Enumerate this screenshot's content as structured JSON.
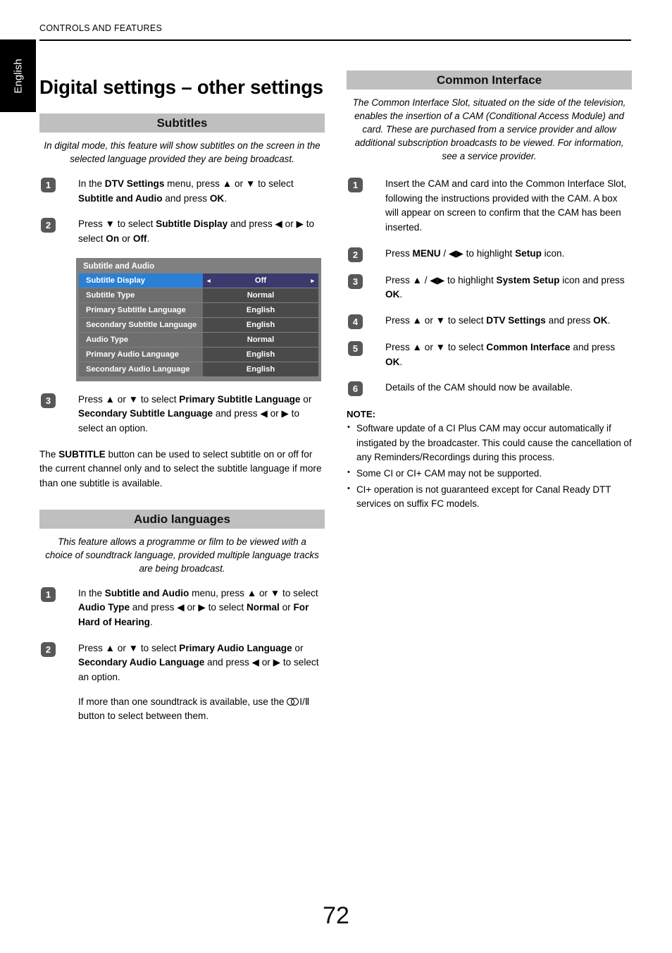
{
  "header": {
    "running_head": "CONTROLS AND FEATURES",
    "language_tab": "English",
    "page_title": "Digital settings – other settings"
  },
  "left_column": {
    "subtitles": {
      "heading": "Subtitles",
      "intro": "In digital mode, this feature will show subtitles on the screen in the selected language provided they are being broadcast.",
      "steps": [
        {
          "number": "1",
          "text_parts": [
            "In the ",
            "DTV Settings",
            " menu, press ▲ or ▼ to select ",
            "Subtitle and Audio",
            " and press ",
            "OK",
            "."
          ]
        },
        {
          "number": "2",
          "text_parts": [
            "Press ▼ to select ",
            "Subtitle Display",
            " and press ◀ or ▶ to select ",
            "On",
            " or ",
            "Off",
            "."
          ]
        },
        {
          "number": "3",
          "text_parts": [
            "Press ▲ or ▼ to select ",
            "Primary Subtitle Language",
            " or ",
            "Secondary Subtitle Language",
            " and press ◀ or ▶ to select an option."
          ]
        }
      ],
      "closing_paragraph": {
        "before": "The ",
        "bold": "SUBTITLE",
        "after": " button can be used to select subtitle on or off for the current channel only and to select the subtitle language if more than one subtitle is available."
      }
    },
    "tv_menu": {
      "title": "Subtitle and Audio",
      "rows": [
        {
          "label": "Subtitle Display",
          "value": "Off",
          "selected": true
        },
        {
          "label": "Subtitle Type",
          "value": "Normal",
          "selected": false
        },
        {
          "label": "Primary Subtitle Language",
          "value": "English",
          "selected": false
        },
        {
          "label": "Secondary Subtitle Language",
          "value": "English",
          "selected": false
        },
        {
          "label": "Audio Type",
          "value": "Normal",
          "selected": false
        },
        {
          "label": "Primary Audio Language",
          "value": "English",
          "selected": false
        },
        {
          "label": "Secondary Audio Language",
          "value": "English",
          "selected": false
        }
      ],
      "caret_left": "◂",
      "caret_right": "▸",
      "colors": {
        "frame": "#808080",
        "label_bg": "#6e6e6e",
        "value_bg": "#4a4a4a",
        "selected_label_bg": "#2b7fd4",
        "selected_value_bg": "#3a3a6e",
        "text": "#ffffff"
      }
    },
    "audio_languages": {
      "heading": "Audio languages",
      "intro": "This feature allows a programme or film to be viewed with a choice of soundtrack language, provided multiple language tracks are being broadcast.",
      "steps": [
        {
          "number": "1",
          "text_parts": [
            "In the ",
            "Subtitle and Audio",
            " menu, press ▲ or ▼ to select ",
            "Audio Type",
            " and press ◀ or ▶ to select ",
            "Normal",
            " or ",
            "For Hard of Hearing",
            "."
          ]
        },
        {
          "number": "2",
          "text_parts": [
            "Press ▲ or ▼ to select ",
            "Primary Audio Language",
            " or ",
            "Secondary Audio Language",
            " and press ◀ or ▶ to select an option."
          ]
        }
      ],
      "sub_note": {
        "before": "If more than one soundtrack is available, use the ",
        "icon": "stereo-dual-sound-icon",
        "icon_label": "I/Ⅱ",
        "after": " button to select between them."
      }
    }
  },
  "right_column": {
    "common_interface": {
      "heading": "Common Interface",
      "intro": "The Common Interface Slot, situated on the side of the television, enables the insertion of a CAM (Conditional Access Module) and card. These are purchased from a service provider and allow additional subscription broadcasts to be viewed. For information, see a service provider.",
      "steps": [
        {
          "number": "1",
          "text_parts": [
            "Insert the CAM and card into the Common Interface Slot, following the instructions provided with the CAM. A box will appear on screen to confirm that the CAM has been inserted."
          ]
        },
        {
          "number": "2",
          "text_parts": [
            "Press ",
            "MENU",
            " / ◀▶ to highlight ",
            "Setup",
            " icon."
          ]
        },
        {
          "number": "3",
          "text_parts": [
            "Press ▲ / ◀▶ to highlight ",
            "System Setup",
            " icon and press ",
            "OK",
            "."
          ]
        },
        {
          "number": "4",
          "text_parts": [
            "Press ▲ or ▼ to select ",
            "DTV Settings",
            " and press ",
            "OK",
            "."
          ]
        },
        {
          "number": "5",
          "text_parts": [
            "Press ▲ or ▼ to select ",
            "Common Interface",
            " and press ",
            "OK",
            "."
          ]
        },
        {
          "number": "6",
          "text_parts": [
            "Details of the CAM should now be available."
          ]
        }
      ],
      "note_title": "NOTE:",
      "notes": [
        "Software update of a CI Plus CAM may occur automatically if instigated by the broadcaster. This could cause the cancellation of any Reminders/Recordings during this process.",
        "Some CI or CI+ CAM may not be supported.",
        "CI+ operation is not guaranteed except for Canal Ready DTT services on suffix FC models."
      ]
    }
  },
  "footer": {
    "page_number": "72"
  }
}
